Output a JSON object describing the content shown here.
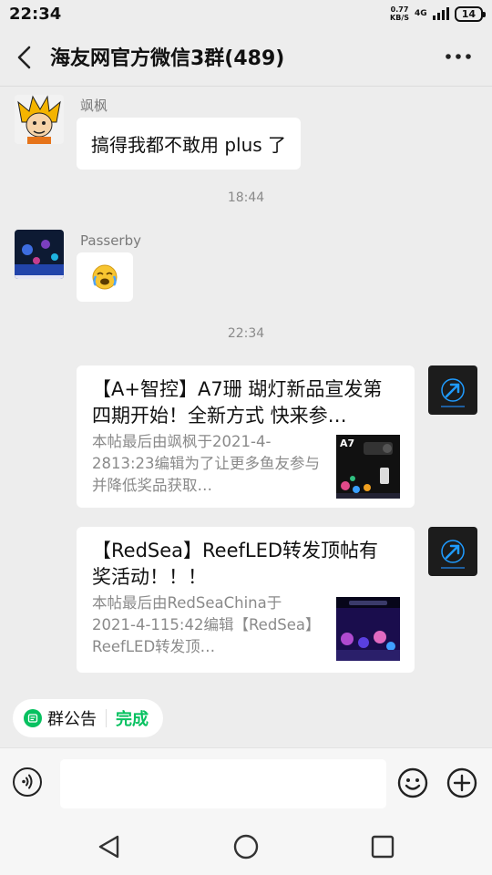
{
  "status_bar": {
    "time": "22:34",
    "speed_value": "0.77",
    "speed_unit": "KB/S",
    "signal": "4G",
    "battery": "14"
  },
  "header": {
    "title": "海友网官方微信3群(489)"
  },
  "messages": [
    {
      "type": "text",
      "sender": "飒枫",
      "text": "搞得我都不敢用 plus 了"
    },
    {
      "type": "time",
      "text": "18:44"
    },
    {
      "type": "emoji",
      "sender": "Passerby",
      "emoji": "😭"
    },
    {
      "type": "time",
      "text": "22:34"
    },
    {
      "type": "card",
      "title": "【A+智控】A7珊 瑚灯新品宣发第四期开始！全新方式  快来参…",
      "desc": "本帖最后由飒枫于2021-4-2813:23编辑为了让更多鱼友参与并降低奖品获取…",
      "thumb_label": "A7"
    },
    {
      "type": "card",
      "title": "【RedSea】ReefLED转发顶帖有奖活动！！！",
      "desc": "本帖最后由RedSeaChina于2021-4-115:42编辑【RedSea】ReefLED转发顶…"
    }
  ],
  "notice": {
    "label": "群公告",
    "done": "完成"
  },
  "input": {
    "placeholder": ""
  },
  "icons": {
    "back": "chevron-left-icon",
    "more": "more-dots-icon",
    "voice": "voice-icon",
    "emoji": "emoji-icon",
    "plus": "plus-icon",
    "nav_back": "triangle-back-icon",
    "nav_home": "circle-home-icon",
    "nav_recent": "square-recent-icon"
  },
  "colors": {
    "accent": "#07c160",
    "background": "#ededed"
  }
}
